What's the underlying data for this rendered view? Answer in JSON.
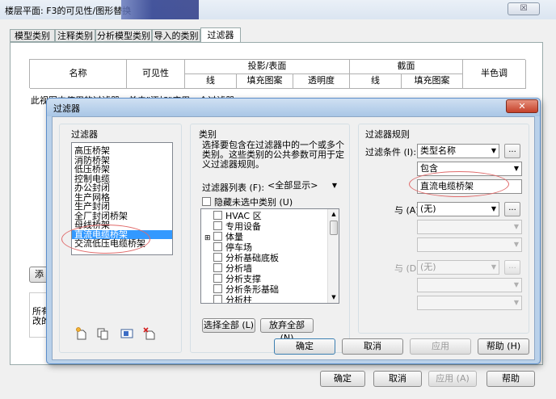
{
  "outer": {
    "title": "楼层平面: F3的可见性/图形替换",
    "close_glyph": "☒",
    "tabs": [
      "模型类别",
      "注释类别",
      "分析模型类别",
      "导入的类别",
      "过滤器"
    ],
    "table_headers": {
      "name": "名称",
      "visibility": "可见性",
      "projection_surface": "投影/表面",
      "line": "线",
      "fill_pattern": "填充图案",
      "transparency": "透明度",
      "cut": "截面",
      "cut_line": "线",
      "cut_fill_pattern": "填充图案",
      "halftone": "半色调"
    },
    "partial_text": "此视图中使用的过滤器，单击\"添加\"应用一个过滤器。",
    "add_button_partial": "添",
    "note_partial_1": "所有",
    "note_partial_2": "改的",
    "ok_button": "确定",
    "cancel_button": "取消",
    "apply_button": "应用 (A)",
    "help_button": "帮助"
  },
  "dialog": {
    "title": "过滤器",
    "close_glyph": "✕",
    "filters_label": "过滤器",
    "filters": [
      "高压桥架",
      "消防桥架",
      "低压桥架",
      "控制电缆",
      "办公封闭",
      "生产网格",
      "生产封闭",
      "全厂封闭桥架",
      "母线桥架",
      "直流电缆桥架",
      "交流低压电缆桥架"
    ],
    "selected_filter_index": 9,
    "categories_label": "类别",
    "categories_desc": "选择要包含在过滤器中的一个或多个类别。这些类别的公共参数可用于定义过滤器规则。",
    "filter_list_label": "过滤器列表 (F):",
    "filter_list_value": "<全部显示>",
    "hide_unchecked_label": "隐藏未选中类别 (U)",
    "categories": [
      {
        "expander": "",
        "label": "HVAC 区"
      },
      {
        "expander": "",
        "label": "专用设备"
      },
      {
        "expander": "⊞",
        "label": "体量"
      },
      {
        "expander": "",
        "label": "停车场"
      },
      {
        "expander": "",
        "label": "分析基础底板"
      },
      {
        "expander": "",
        "label": "分析墙"
      },
      {
        "expander": "",
        "label": "分析支撑"
      },
      {
        "expander": "",
        "label": "分析条形基础"
      },
      {
        "expander": "",
        "label": "分析柱"
      }
    ],
    "select_all_button": "选择全部 (L)",
    "deselect_all_button": "放弃全部 (N)",
    "rules_label": "过滤器规则",
    "filter_by_label": "过滤条件 (I):",
    "filter_by_value": "类型名称",
    "operator_value": "包含",
    "rule_value": "直流电缆桥架",
    "and_label_1": "与 (A):",
    "and_value_1": "(无)",
    "and_label_2": "与 (D):",
    "and_value_2": "(无)",
    "more_glyph": "...",
    "ok_button": "确定",
    "cancel_button": "取消",
    "apply_button": "应用",
    "help_button": "帮助 (H)"
  },
  "colors": {
    "dialog_frame": "#5b8dc9",
    "title_bar": "#7aa3d4",
    "selection": "#3399ff",
    "annotation_ring": "#e06a6a"
  }
}
